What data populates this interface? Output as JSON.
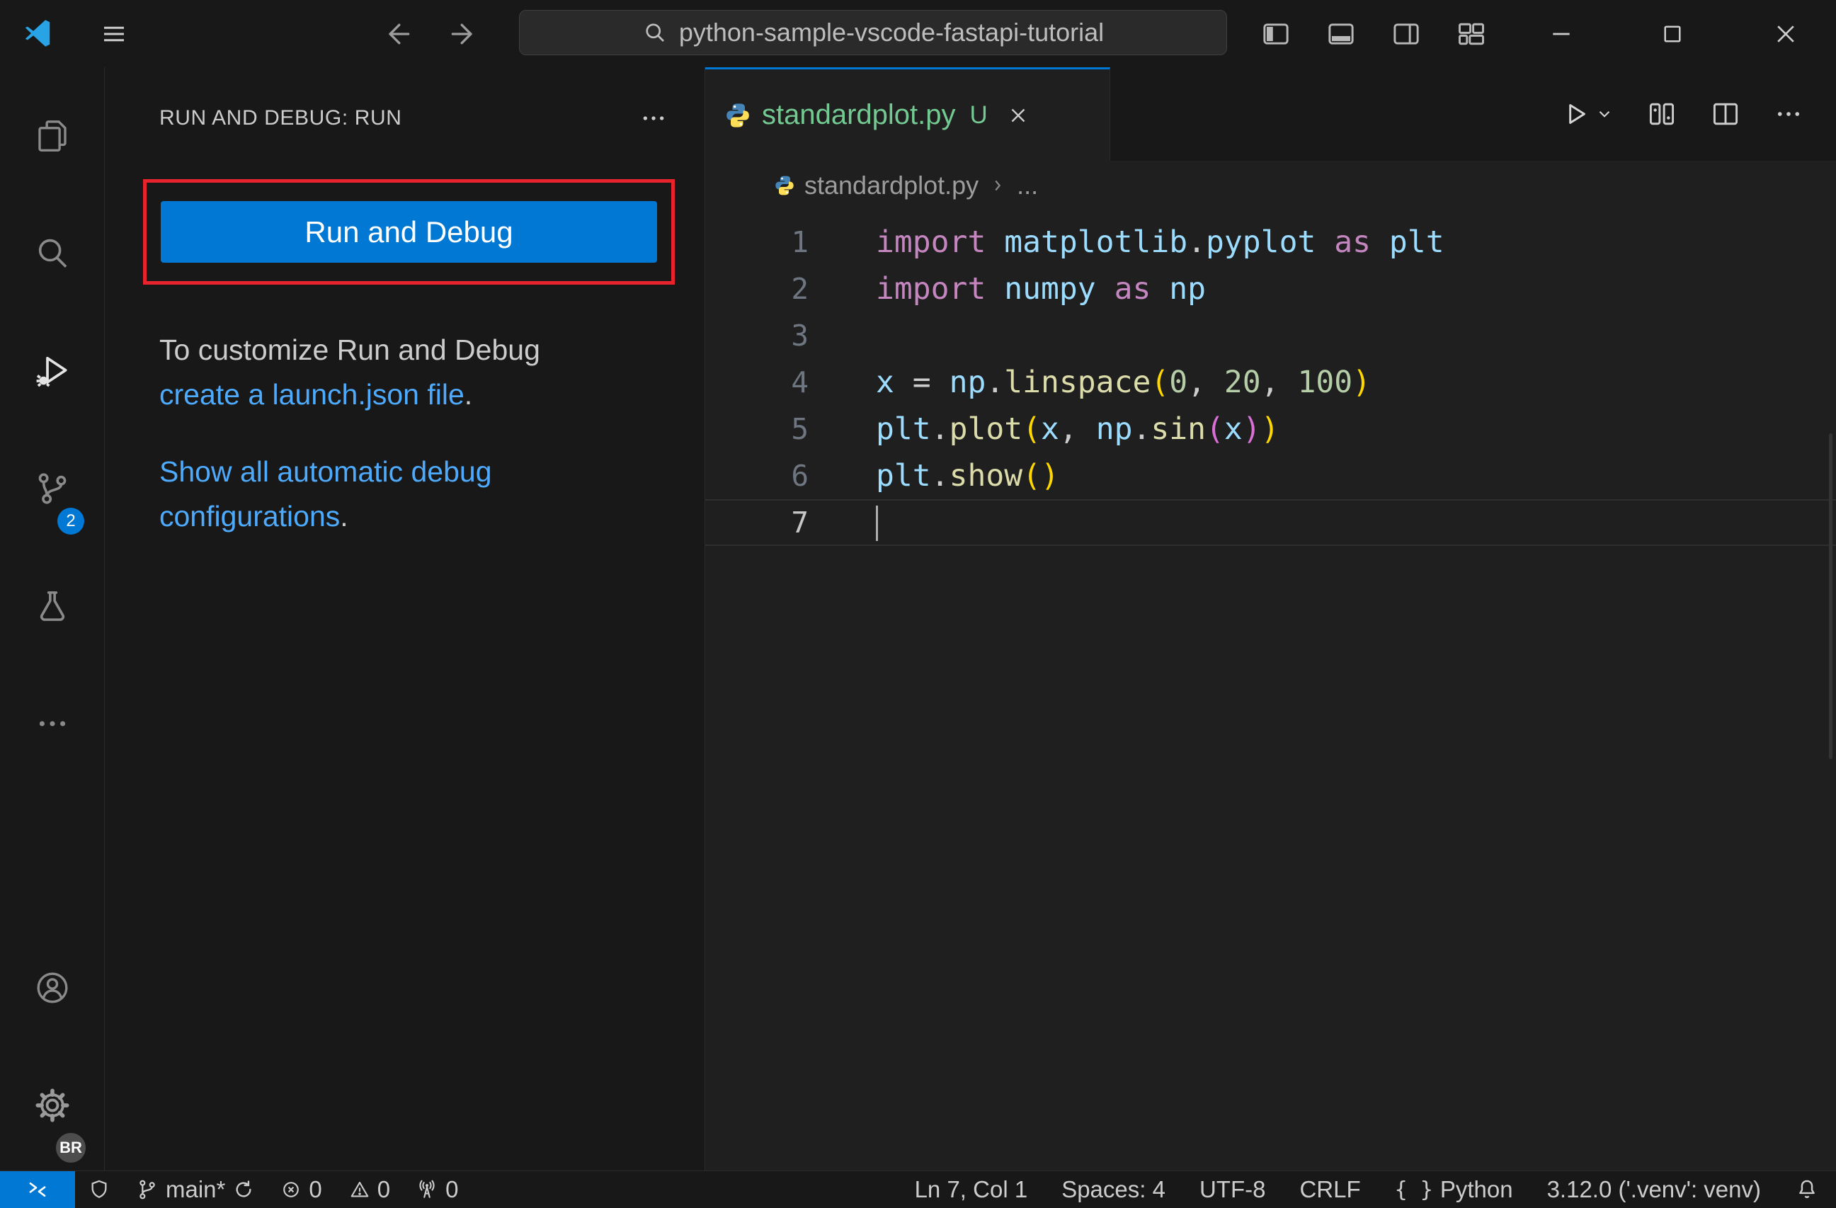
{
  "title_bar": {
    "command_center_text": "python-sample-vscode-fastapi-tutorial"
  },
  "activity_bar": {
    "scm_badge": "2",
    "profile_badge": "BR"
  },
  "sidebar": {
    "header_title": "RUN AND DEBUG: RUN",
    "run_button_label": "Run and Debug",
    "customize_line": "To customize Run and Debug",
    "launch_json_link": "create a launch.json file",
    "launch_json_suffix": ".",
    "show_configs_link": "Show all automatic debug configurations",
    "show_configs_suffix": "."
  },
  "editor": {
    "tab": {
      "label": "standardplot.py",
      "git_status": "U"
    },
    "breadcrumb": {
      "file": "standardplot.py",
      "more": "..."
    },
    "code_lines": [
      {
        "num": "1",
        "tokens": [
          [
            "import",
            "kw"
          ],
          [
            " ",
            "pl"
          ],
          [
            "matplotlib",
            "id"
          ],
          [
            ".",
            "pl"
          ],
          [
            "pyplot",
            "id"
          ],
          [
            " ",
            "pl"
          ],
          [
            "as",
            "kw"
          ],
          [
            " ",
            "pl"
          ],
          [
            "plt",
            "id"
          ]
        ]
      },
      {
        "num": "2",
        "tokens": [
          [
            "import",
            "kw"
          ],
          [
            " ",
            "pl"
          ],
          [
            "numpy",
            "id"
          ],
          [
            " ",
            "pl"
          ],
          [
            "as",
            "kw"
          ],
          [
            " ",
            "pl"
          ],
          [
            "np",
            "id"
          ]
        ]
      },
      {
        "num": "3",
        "tokens": []
      },
      {
        "num": "4",
        "tokens": [
          [
            "x",
            "id"
          ],
          [
            " = ",
            "pl"
          ],
          [
            "np",
            "id"
          ],
          [
            ".",
            "pl"
          ],
          [
            "linspace",
            "fn"
          ],
          [
            "(",
            "b1"
          ],
          [
            "0",
            "num"
          ],
          [
            ", ",
            "pl"
          ],
          [
            "20",
            "num"
          ],
          [
            ", ",
            "pl"
          ],
          [
            "100",
            "num"
          ],
          [
            ")",
            "b1"
          ]
        ]
      },
      {
        "num": "5",
        "tokens": [
          [
            "plt",
            "id"
          ],
          [
            ".",
            "pl"
          ],
          [
            "plot",
            "fn"
          ],
          [
            "(",
            "b1"
          ],
          [
            "x",
            "id"
          ],
          [
            ", ",
            "pl"
          ],
          [
            "np",
            "id"
          ],
          [
            ".",
            "pl"
          ],
          [
            "sin",
            "fn"
          ],
          [
            "(",
            "b2"
          ],
          [
            "x",
            "id"
          ],
          [
            ")",
            "b2"
          ],
          [
            ")",
            "b1"
          ]
        ]
      },
      {
        "num": "6",
        "tokens": [
          [
            "plt",
            "id"
          ],
          [
            ".",
            "pl"
          ],
          [
            "show",
            "fn"
          ],
          [
            "(",
            "b1"
          ],
          [
            ")",
            "b1"
          ]
        ]
      },
      {
        "num": "7",
        "tokens": [],
        "active": true
      }
    ]
  },
  "status_bar": {
    "branch": "main*",
    "errors": "0",
    "warnings": "0",
    "ports": "0",
    "line_col": "Ln 7, Col 1",
    "indent": "Spaces: 4",
    "encoding": "UTF-8",
    "eol": "CRLF",
    "language_icon": "{ }",
    "language": "Python",
    "interpreter": "3.12.0 ('.venv': venv)"
  },
  "colors": {
    "accent_blue": "#0078d4",
    "link_blue": "#4daafc",
    "annotation_red": "#e8232b",
    "git_untracked": "#73c991",
    "python_logo_blue": "#4584b6",
    "python_logo_yellow": "#ffde57"
  }
}
